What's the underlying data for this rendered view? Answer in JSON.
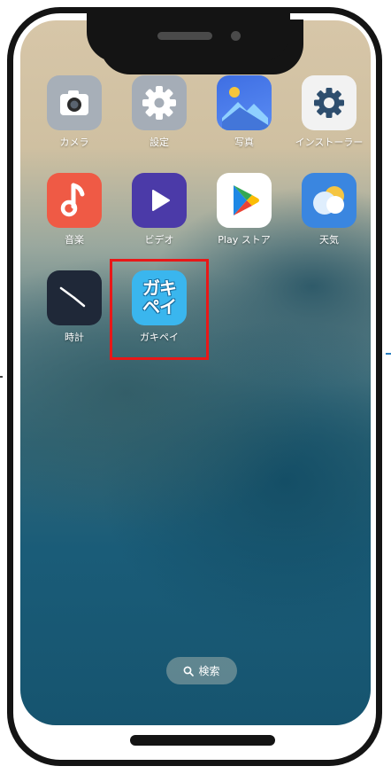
{
  "apps": [
    {
      "id": "camera",
      "label": "カメラ",
      "icon": "camera-icon",
      "color": "#a7afb8"
    },
    {
      "id": "settings",
      "label": "設定",
      "icon": "gear-icon",
      "color": "#a5adb7"
    },
    {
      "id": "photos",
      "label": "写真",
      "icon": "photo-icon",
      "color": "#4a73e8"
    },
    {
      "id": "installer",
      "label": "インストーラー",
      "icon": "installer-gear-icon",
      "color": "#f0f0f0"
    },
    {
      "id": "music",
      "label": "音楽",
      "icon": "music-note-icon",
      "color": "#ef5a45"
    },
    {
      "id": "video",
      "label": "ビデオ",
      "icon": "play-icon",
      "color": "#4b3aa8"
    },
    {
      "id": "playstore",
      "label": "Play ストア",
      "icon": "play-store-icon",
      "color": "#ffffff"
    },
    {
      "id": "weather",
      "label": "天気",
      "icon": "weather-icon",
      "color": "#3a86e0"
    },
    {
      "id": "clock",
      "label": "時計",
      "icon": "clock-icon",
      "color": "#1f2838"
    },
    {
      "id": "gakipay",
      "label": "ガキペイ",
      "icon_text_top": "ガキ",
      "icon_text_bottom": "ペイ",
      "icon": "gakipay-logo-icon",
      "color": "#3ab6ee"
    }
  ],
  "search": {
    "label": "検索",
    "icon": "search-icon"
  },
  "highlight_color": "#e81818"
}
